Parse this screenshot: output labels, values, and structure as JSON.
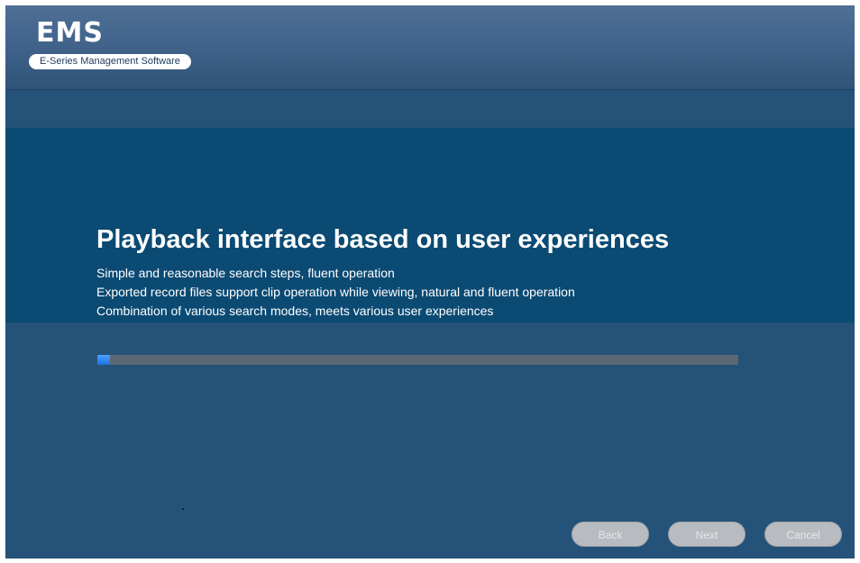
{
  "header": {
    "logo_title": "EMS",
    "logo_subtitle": "E-Series Management Software"
  },
  "feature": {
    "title": "Playback interface based on user experiences",
    "items": [
      "Simple and reasonable search steps, fluent operation",
      "Exported record files support clip operation while viewing, natural and fluent operation",
      "Combination of various search modes, meets various user experiences"
    ]
  },
  "progress": {
    "percent": 2
  },
  "buttons": {
    "back": "Back",
    "next": "Next",
    "cancel": "Cancel"
  },
  "colors": {
    "background": "#255278",
    "band": "#0b4a73",
    "progress_track": "#5b6873",
    "progress_fill": "#1f70e0",
    "button_disabled": "#b8bcc0"
  }
}
